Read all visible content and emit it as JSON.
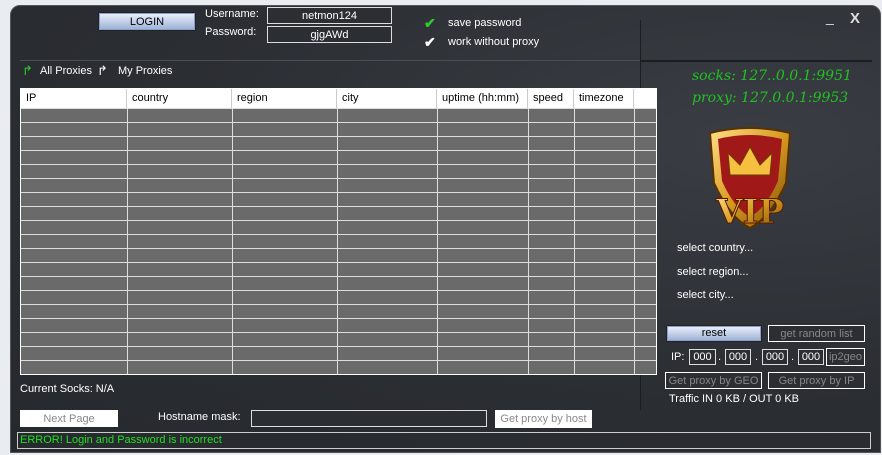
{
  "login": {
    "button": "LOGIN",
    "username_label": "Username:",
    "username": "netmon124",
    "password_label": "Password:",
    "password": "gjgAWd"
  },
  "options": {
    "save_password": "save password",
    "work_without_proxy": "work without proxy"
  },
  "window": {
    "minimize": "_",
    "close": "X"
  },
  "tabs": {
    "all": "All Proxies",
    "my": "My Proxies"
  },
  "table": {
    "columns": [
      "IP",
      "country",
      "region",
      "city",
      "uptime (hh:mm)",
      "speed",
      "timezone"
    ],
    "rows": []
  },
  "status": {
    "socks": "socks: 127..0.0.1:9951",
    "proxy": "proxy: 127.0.0.1:9953"
  },
  "logo": {
    "text": "VIP"
  },
  "geo": {
    "country": "select country...",
    "region": "select region...",
    "city": "select city..."
  },
  "controls": {
    "reset": "reset",
    "random": "get random list",
    "ip_label": "IP:",
    "ip": [
      "000",
      "000",
      "000",
      "000"
    ],
    "ip2geo": "ip2geo",
    "by_geo": "Get proxy by GEO",
    "by_ip": "Get proxy by IP",
    "traffic": "Traffic IN 0 KB / OUT 0 KB"
  },
  "bottom": {
    "current_socks": "Current Socks: N/A",
    "next_page": "Next Page",
    "hostname_label": "Hostname mask:",
    "hostname": "",
    "by_host": "Get proxy by host",
    "error": "ERROR! Login and Password is incorrect"
  },
  "colors": {
    "accent_green": "#22c022",
    "window_bg": "#2b2e33"
  }
}
